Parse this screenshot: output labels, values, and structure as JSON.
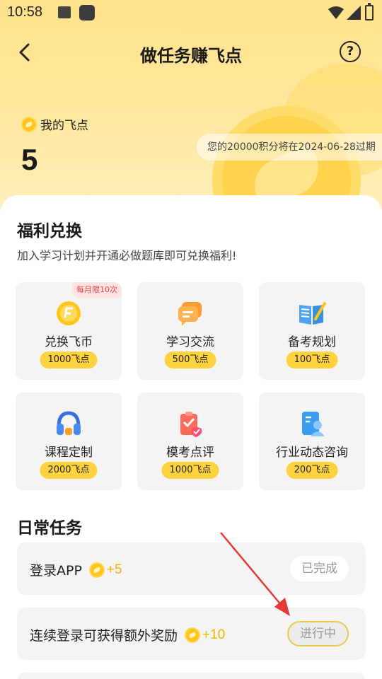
{
  "status_bar": {
    "time": "10:58"
  },
  "header": {
    "title": "做任务赚飞点"
  },
  "points": {
    "label": "我的飞点",
    "value": "5",
    "expire_note": "您的20000积分将在2024-06-28过期"
  },
  "welfare": {
    "title": "福利兑换",
    "subtitle": "加入学习计划并开通必做题库即可兑换福利!",
    "items": [
      {
        "name": "兑换飞币",
        "cost": "1000飞点",
        "badge": "每月限10次",
        "icon": "coin-icon"
      },
      {
        "name": "学习交流",
        "cost": "500飞点",
        "icon": "chat-icon"
      },
      {
        "name": "备考规划",
        "cost": "100飞点",
        "icon": "book-icon"
      },
      {
        "name": "课程定制",
        "cost": "2000飞点",
        "icon": "headphones-icon"
      },
      {
        "name": "模考点评",
        "cost": "1000飞点",
        "icon": "clipboard-icon"
      },
      {
        "name": "行业动态咨询",
        "cost": "200飞点",
        "icon": "contact-card-icon"
      }
    ]
  },
  "daily": {
    "title": "日常任务",
    "tasks": [
      {
        "label": "登录APP",
        "bonus": "+5",
        "status": "已完成"
      },
      {
        "label": "连续登录可获得额外奖励",
        "bonus": "+10",
        "status": "进行中"
      }
    ]
  },
  "colors": {
    "accent": "#ffd23f",
    "annotation_arrow": "#e53935"
  }
}
